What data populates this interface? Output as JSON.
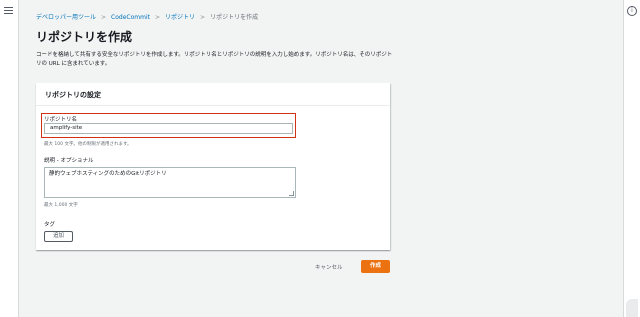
{
  "breadcrumb": {
    "items": [
      "デベロッパー用ツール",
      "CodeCommit",
      "リポジトリ",
      "リポジトリを作成"
    ],
    "separator": ">"
  },
  "page": {
    "title": "リポジトリを作成",
    "description": "コードを格納して共有する安全なリポジトリを作成します。リポジトリ名とリポジトリの説明を入力し始めます。リポジトリ名は、そのリポジトリの URL に含まれています。"
  },
  "card": {
    "title": "リポジトリの設定"
  },
  "form": {
    "name_label": "リポジトリ名",
    "name_value": "amplify-site",
    "name_hint": "最大 100 文字。他の制限が適用されます。",
    "description_label": "説明 - オプショナル",
    "description_value": "静的ウェブホスティングのためのGitリポジトリ",
    "description_hint": "最大 1,000 文字",
    "tags_label": "タグ",
    "add_button_label": "追加"
  },
  "actions": {
    "cancel_label": "キャンセル",
    "create_label": "作成"
  },
  "icons": {
    "menu": "hamburger-menu-icon",
    "info": "info-icon"
  },
  "colors": {
    "primary_button": "#ec7211",
    "link": "#0073bb",
    "highlight_border": "#d13212"
  }
}
